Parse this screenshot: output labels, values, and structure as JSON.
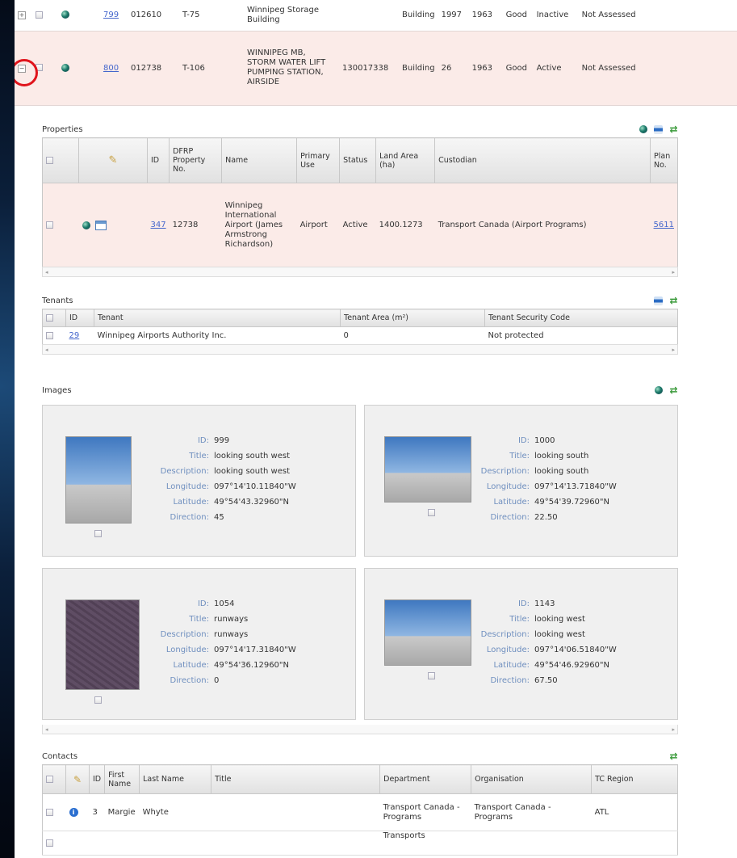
{
  "top_rows": [
    {
      "id": "799",
      "num": "012610",
      "code": "T-75",
      "name": "Winnipeg Storage Building",
      "code2": "",
      "type": "Building",
      "val": "1997",
      "year": "1963",
      "cond": "Good",
      "status": "Inactive",
      "assess": "Not Assessed"
    },
    {
      "id": "800",
      "num": "012738",
      "code": "T-106",
      "name": "WINNIPEG MB, STORM WATER LIFT PUMPING STATION, AIRSIDE",
      "code2": "130017338",
      "type": "Building",
      "val": "26",
      "year": "1963",
      "cond": "Good",
      "status": "Active",
      "assess": "Not Assessed"
    }
  ],
  "properties": {
    "title": "Properties",
    "headers": {
      "id": "ID",
      "dfrp": "DFRP Property No.",
      "name": "Name",
      "use": "Primary Use",
      "status": "Status",
      "area": "Land Area (ha)",
      "custodian": "Custodian",
      "plan": "Plan No."
    },
    "row": {
      "id": "347",
      "dfrp": "12738",
      "name": "Winnipeg International Airport (James Armstrong Richardson)",
      "use": "Airport",
      "status": "Active",
      "area": "1400.1273",
      "custodian": "Transport Canada (Airport Programs)",
      "plan": "5611"
    }
  },
  "tenants": {
    "title": "Tenants",
    "headers": {
      "id": "ID",
      "tenant": "Tenant",
      "area": "Tenant Area (m²)",
      "code": "Tenant Security Code"
    },
    "row": {
      "id": "29",
      "tenant": "Winnipeg Airports Authority Inc.",
      "area": "0",
      "code": "Not protected"
    }
  },
  "images": {
    "title": "Images",
    "labels": {
      "id": "ID:",
      "title": "Title:",
      "desc": "Description:",
      "lon": "Longitude:",
      "lat": "Latitude:",
      "dir": "Direction:"
    },
    "items": [
      {
        "id": "999",
        "title": "looking south west",
        "desc": "looking south west",
        "lon": "097°14'10.11840\"W",
        "lat": "49°54'43.32960\"N",
        "dir": "45"
      },
      {
        "id": "1000",
        "title": "looking south",
        "desc": "looking south",
        "lon": "097°14'13.71840\"W",
        "lat": "49°54'39.72960\"N",
        "dir": "22.50"
      },
      {
        "id": "1054",
        "title": "runways",
        "desc": "runways",
        "lon": "097°14'17.31840\"W",
        "lat": "49°54'36.12960\"N",
        "dir": "0"
      },
      {
        "id": "1143",
        "title": "looking west",
        "desc": "looking west",
        "lon": "097°14'06.51840\"W",
        "lat": "49°54'46.92960\"N",
        "dir": "67.50"
      }
    ]
  },
  "contacts": {
    "title": "Contacts",
    "headers": {
      "id": "ID",
      "first": "First Name",
      "last": "Last Name",
      "title": "Title",
      "dept": "Department",
      "org": "Organisation",
      "region": "TC Region"
    },
    "row": {
      "id": "3",
      "first": "Margie",
      "last": "Whyte",
      "title": "",
      "dept": "Transport Canada - Programs",
      "org": "Transport Canada - Programs",
      "region": "ATL"
    },
    "partial_dept": "Transports"
  }
}
